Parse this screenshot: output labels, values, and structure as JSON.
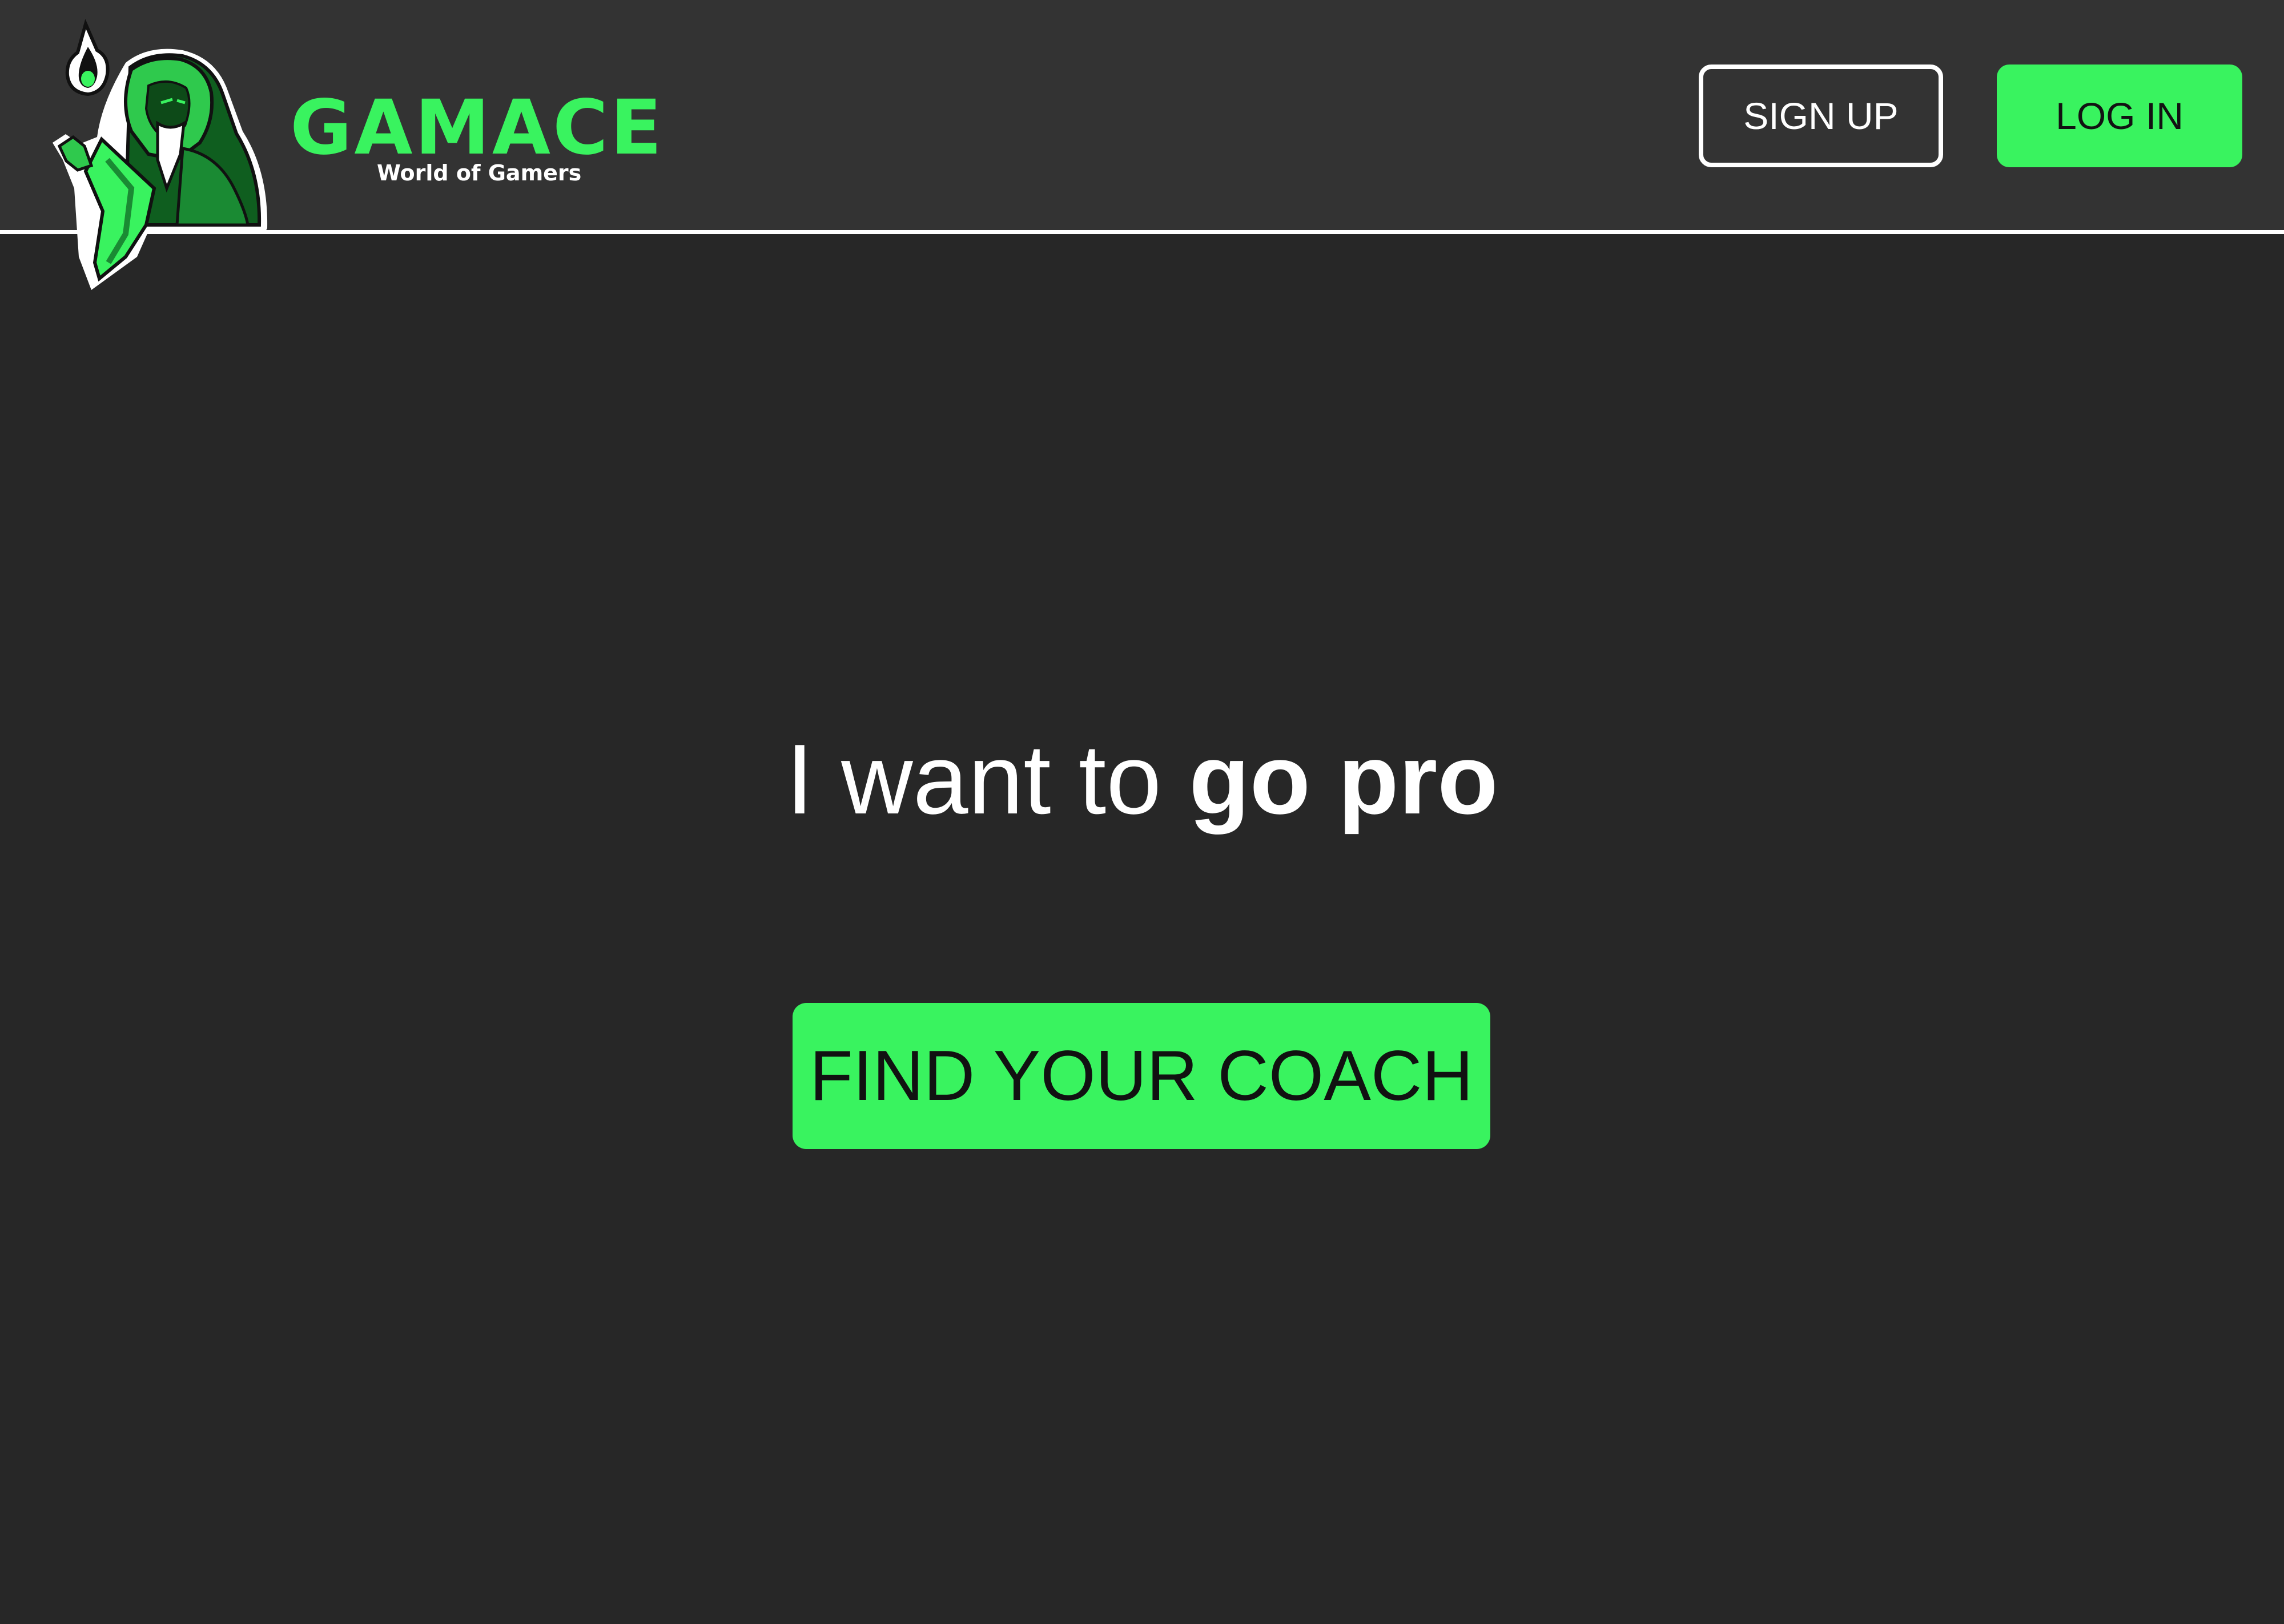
{
  "brand": {
    "name": "GAMACE",
    "tagline": "World of Gamers",
    "mascot_icon": "hooded-wizard-mascot-icon"
  },
  "header": {
    "signup_label": "SIGN UP",
    "login_label": "LOG IN"
  },
  "hero": {
    "title_regular": "I want to",
    "title_bold": "go pro",
    "cta_label": "FIND YOUR COACH"
  },
  "colors": {
    "accent": "#39f35f",
    "header_bg": "#333333",
    "page_bg": "#272727",
    "text_light": "#ffffff",
    "text_dark": "#111111"
  }
}
